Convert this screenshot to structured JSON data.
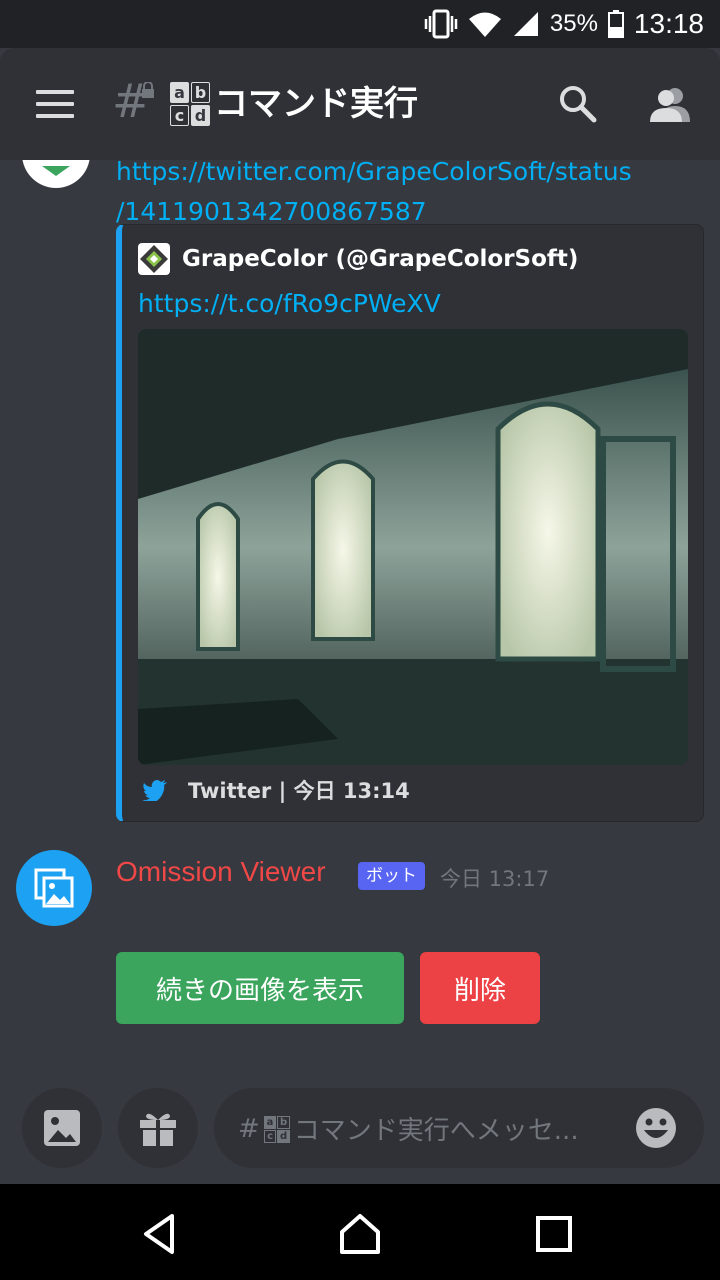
{
  "status_bar": {
    "battery": "35%",
    "time": "13:18"
  },
  "channel": {
    "hash": "#",
    "badge_chars": [
      "a",
      "b",
      "c",
      "d"
    ],
    "name": "コマンド実行"
  },
  "message1": {
    "link_line1": "https://twitter.com/GrapeColorSoft/status",
    "link_line2": "/1411901342700867587",
    "embed": {
      "author": "GrapeColor (@GrapeColorSoft)",
      "url": "https://t.co/fRo9cPWeXV",
      "image_alt": "abandoned-building-photo",
      "footer": "Twitter | 今日 13:14"
    }
  },
  "message2": {
    "author": "Omission Viewer",
    "bot_badge": "ボット",
    "time": "今日 13:17",
    "buttons": {
      "show_more": "続きの画像を表示",
      "delete": "削除"
    }
  },
  "composer": {
    "placeholder": "コマンド実行へメッセ..."
  },
  "colors": {
    "link": "#00aff4",
    "bot_name": "#f04747",
    "green_button": "#3ba55d",
    "red_button": "#ed4245",
    "twitter": "#1da1f2",
    "badge": "#5865f2"
  }
}
